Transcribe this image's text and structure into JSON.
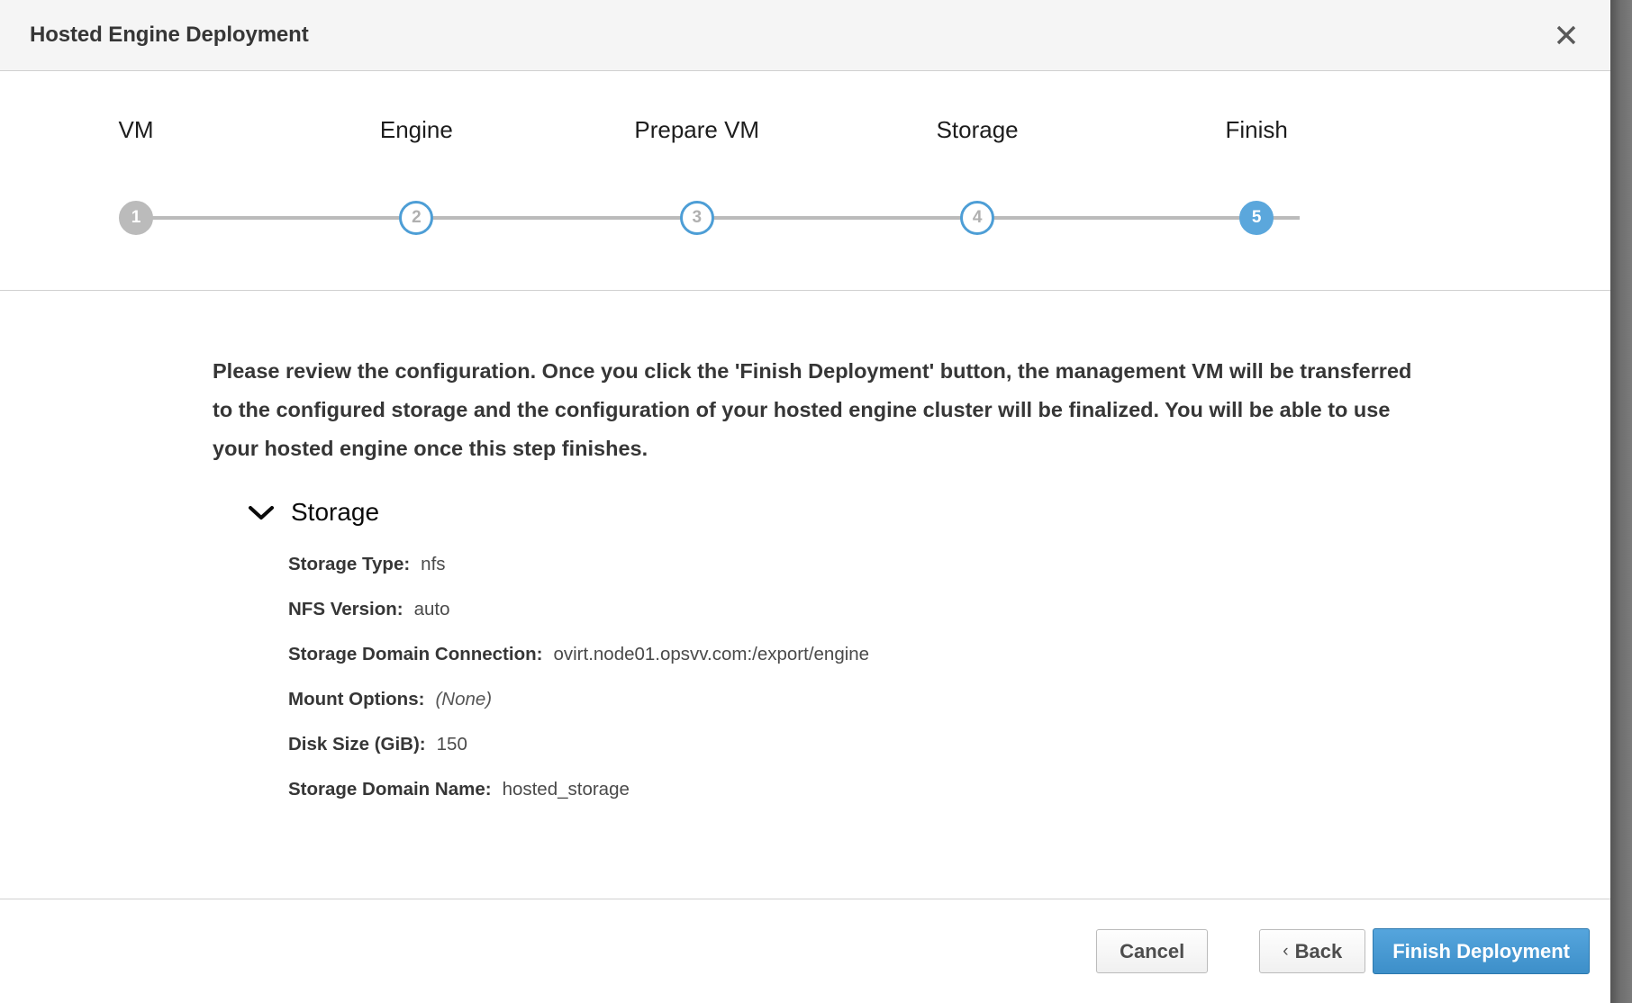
{
  "window": {
    "title": "Hosted Engine Deployment",
    "close_icon": "close-icon"
  },
  "stepper": {
    "steps": [
      {
        "number": "1",
        "label": "VM",
        "state": "done"
      },
      {
        "number": "2",
        "label": "Engine",
        "state": "pending"
      },
      {
        "number": "3",
        "label": "Prepare VM",
        "state": "pending"
      },
      {
        "number": "4",
        "label": "Storage",
        "state": "pending"
      },
      {
        "number": "5",
        "label": "Finish",
        "state": "active"
      }
    ],
    "track_color": "#bbbbbb",
    "active_color": "#5ba7dc",
    "done_color": "#bbbbbb"
  },
  "body": {
    "intro": "Please review the configuration. Once you click the 'Finish Deployment' button, the management VM will be transferred to the configured storage and the configuration of your hosted engine cluster will be finalized. You will be able to use your hosted engine once this step finishes.",
    "section": {
      "title": "Storage",
      "expanded": true,
      "chevron_icon": "chevron-down-icon",
      "rows": [
        {
          "label": "Storage Type:",
          "value": "nfs",
          "italic": false
        },
        {
          "label": "NFS Version:",
          "value": "auto",
          "italic": false
        },
        {
          "label": "Storage Domain Connection:",
          "value": "ovirt.node01.opsvv.com:/export/engine",
          "italic": false
        },
        {
          "label": "Mount Options:",
          "value": "(None)",
          "italic": true
        },
        {
          "label": "Disk Size (GiB):",
          "value": "150",
          "italic": false
        },
        {
          "label": "Storage Domain Name:",
          "value": "hosted_storage",
          "italic": false
        }
      ]
    }
  },
  "footer": {
    "cancel_label": "Cancel",
    "back_caret": "‹",
    "back_label": "Back",
    "finish_label": "Finish Deployment",
    "primary_color": "#3d8fc9"
  }
}
